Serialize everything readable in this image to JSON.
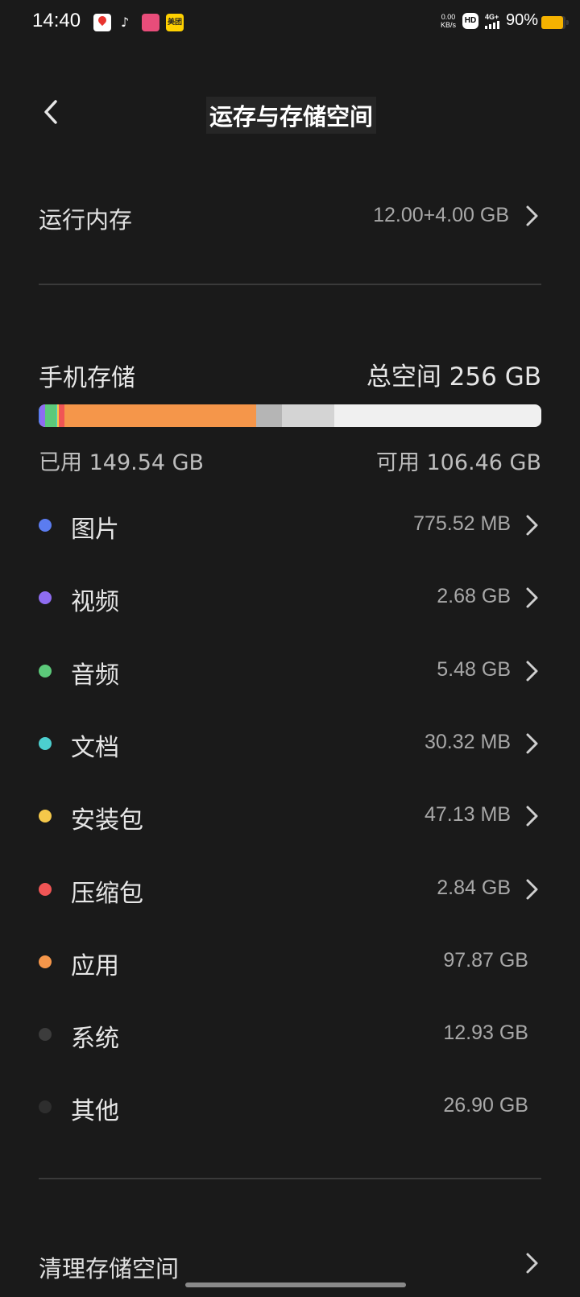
{
  "status_bar": {
    "time": "14:40",
    "meituan_label": "美团",
    "net_speed_value": "0.00",
    "net_speed_unit": "KB/s",
    "hd": "HD",
    "network_type": "4G+",
    "battery_percent": "90%",
    "battery_level": 0.9,
    "battery_color": "#f5b200"
  },
  "header": {
    "title": "运存与存储空间",
    "back_icon": "chevron-left-icon"
  },
  "ram": {
    "label": "运行内存",
    "value": "12.00+4.00 GB"
  },
  "storage": {
    "title": "手机存储",
    "total": "总空间 256 GB",
    "used": "已用 149.54 GB",
    "free": "可用 106.46 GB",
    "bar_background": "#f0f0f0",
    "bar_segments": [
      {
        "name": "图片",
        "value_gb": 0.76,
        "color": "#5b7cf0"
      },
      {
        "name": "视频",
        "value_gb": 2.68,
        "color": "#8e6cf0"
      },
      {
        "name": "音频",
        "value_gb": 5.48,
        "color": "#5cc97a"
      },
      {
        "name": "文档",
        "value_gb": 0.03,
        "color": "#4ccfcf"
      },
      {
        "name": "安装包",
        "value_gb": 0.05,
        "color": "#f5c84a"
      },
      {
        "name": "压缩包",
        "value_gb": 2.84,
        "color": "#f05555"
      },
      {
        "name": "应用",
        "value_gb": 97.87,
        "color": "#f5964a"
      },
      {
        "name": "系统",
        "value_gb": 12.93,
        "color": "#b5b5b5"
      },
      {
        "name": "其他",
        "value_gb": 26.9,
        "color": "#d4d4d4"
      }
    ]
  },
  "categories": [
    {
      "label": "图片",
      "size": "775.52 MB",
      "color": "#5b7cf0",
      "has_arrow": true
    },
    {
      "label": "视频",
      "size": "2.68 GB",
      "color": "#8e6cf0",
      "has_arrow": true
    },
    {
      "label": "音频",
      "size": "5.48 GB",
      "color": "#5cc97a",
      "has_arrow": true
    },
    {
      "label": "文档",
      "size": "30.32 MB",
      "color": "#4ccfcf",
      "has_arrow": true
    },
    {
      "label": "安装包",
      "size": "47.13 MB",
      "color": "#f5c84a",
      "has_arrow": true
    },
    {
      "label": "压缩包",
      "size": "2.84 GB",
      "color": "#f05555",
      "has_arrow": true
    },
    {
      "label": "应用",
      "size": "97.87 GB",
      "color": "#f5964a",
      "has_arrow": false
    },
    {
      "label": "系统",
      "size": "12.93 GB",
      "color": "#3c3c3c",
      "has_arrow": false
    },
    {
      "label": "其他",
      "size": "26.90 GB",
      "color": "#2e2e2e",
      "has_arrow": false
    }
  ],
  "clean": {
    "label": "清理存储空间"
  }
}
